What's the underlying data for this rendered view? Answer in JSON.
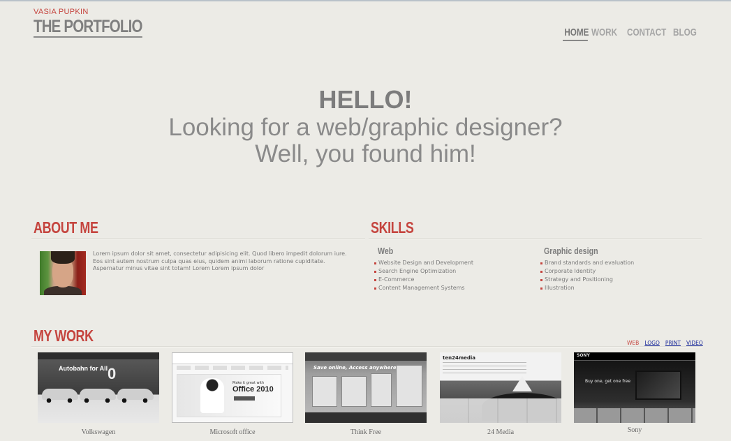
{
  "header": {
    "owner_name": "VASIA PUPKIN",
    "site_title": "THE PORTFOLIO",
    "nav": [
      "HOME",
      "WORK",
      "CONTACT",
      "BLOG"
    ],
    "active_nav": "HOME"
  },
  "hero": {
    "greeting": "HELLO!",
    "line1": "Looking for a web/graphic designer?",
    "line2": "Well, you found him!"
  },
  "about": {
    "title": "ABOUT ME",
    "text": "Lorem ipsum dolor sit amet, consectetur adipisicing elit. Quod libero impedit dolorum iure. Eos sint autem nostrum culpa quas eius, quidem animi laborum ratione cupiditate. Aspernatur minus vitae sint totam! Lorem Lorem ipsum dolor"
  },
  "skills": {
    "title": "SKILLS",
    "web": {
      "heading": "Web",
      "items": [
        "Website Design and Development",
        "Search Engine Optimization",
        "E-Commerce",
        "Content Management Systems"
      ]
    },
    "graphic": {
      "heading": "Graphic design",
      "items": [
        "Brand standards and evaluation",
        "Corporate Identity",
        "Strategy and Positioning",
        "Illustration"
      ]
    }
  },
  "work": {
    "title": "MY WORK",
    "filters": [
      "WEB",
      "LOGO",
      "PRINT",
      "VIDEO"
    ],
    "active_filter": "WEB",
    "items": [
      {
        "caption": "Volkswagen",
        "thumb_text": "Autobahn for All",
        "thumb_big": "0"
      },
      {
        "caption": "Microsoft office",
        "thumb_text": "Make it great with",
        "thumb_big": "Office 2010"
      },
      {
        "caption": "Think Free",
        "thumb_text": "Save online, Access anywhere"
      },
      {
        "caption": "24 Media",
        "thumb_text": "ten24media"
      },
      {
        "caption": "Sony",
        "thumb_text": "SONY",
        "thumb_sub": "Buy one, get one free"
      }
    ]
  },
  "colors": {
    "accent": "#c5453f",
    "background": "#ecebe6",
    "text": "#6e6e6e",
    "link": "#1a2a9a"
  }
}
